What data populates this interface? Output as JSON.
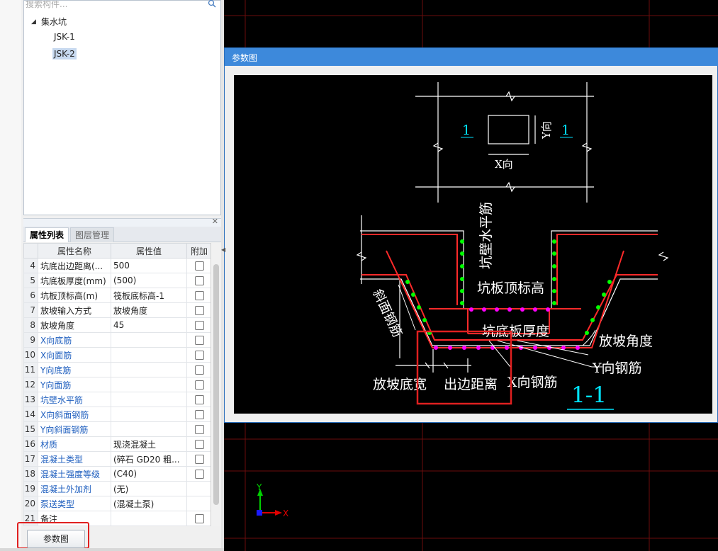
{
  "search": {
    "placeholder": "搜索构件..."
  },
  "tree": {
    "root": "集水坑",
    "items": [
      "JSK-1",
      "JSK-2"
    ],
    "selected": "JSK-2"
  },
  "prop_panel": {
    "tabs": [
      {
        "label": "属性列表",
        "active": true
      },
      {
        "label": "图层管理",
        "active": false
      }
    ],
    "headers": [
      "属性名称",
      "属性值",
      "附加"
    ],
    "rows": [
      {
        "n": "4",
        "name": "坑底出边距离(...",
        "value": "500",
        "blue": false,
        "checkbox": true
      },
      {
        "n": "5",
        "name": "坑底板厚度(mm)",
        "value": "(500)",
        "blue": false,
        "checkbox": true
      },
      {
        "n": "6",
        "name": "坑板顶标高(m)",
        "value": "筏板底标高-1",
        "blue": false,
        "checkbox": true
      },
      {
        "n": "7",
        "name": "放坡输入方式",
        "value": "放坡角度",
        "blue": false,
        "checkbox": true
      },
      {
        "n": "8",
        "name": "放坡角度",
        "value": "45",
        "blue": false,
        "checkbox": true
      },
      {
        "n": "9",
        "name": "X向底筋",
        "value": "",
        "blue": true,
        "checkbox": true
      },
      {
        "n": "10",
        "name": "X向面筋",
        "value": "",
        "blue": true,
        "checkbox": true
      },
      {
        "n": "11",
        "name": "Y向底筋",
        "value": "",
        "blue": true,
        "checkbox": true
      },
      {
        "n": "12",
        "name": "Y向面筋",
        "value": "",
        "blue": true,
        "checkbox": true
      },
      {
        "n": "13",
        "name": "坑壁水平筋",
        "value": "",
        "blue": true,
        "checkbox": true
      },
      {
        "n": "14",
        "name": "X向斜面钢筋",
        "value": "",
        "blue": true,
        "checkbox": true
      },
      {
        "n": "15",
        "name": "Y向斜面钢筋",
        "value": "",
        "blue": true,
        "checkbox": true
      },
      {
        "n": "16",
        "name": "材质",
        "value": "现浇混凝土",
        "blue": true,
        "checkbox": true
      },
      {
        "n": "17",
        "name": "混凝土类型",
        "value": "(碎石 GD20 粗...",
        "blue": true,
        "checkbox": true
      },
      {
        "n": "18",
        "name": "混凝土强度等级",
        "value": "(C40)",
        "blue": true,
        "checkbox": true
      },
      {
        "n": "19",
        "name": "混凝土外加剂",
        "value": "(无)",
        "blue": true,
        "checkbox": false
      },
      {
        "n": "20",
        "name": "泵送类型",
        "value": "(混凝土泵)",
        "blue": true,
        "checkbox": false
      },
      {
        "n": "21",
        "name": "备注",
        "value": "",
        "blue": false,
        "checkbox": true
      }
    ]
  },
  "buttons": {
    "param_diagram": "参数图"
  },
  "dialog": {
    "title": "参数图"
  },
  "diagram": {
    "plan_label_left": "1",
    "plan_label_right": "1",
    "x_dir": "X向",
    "y_dir": "Y向",
    "wall_horizontal_bar": "坑壁水平筋",
    "slab_top_elev": "坑板顶标高",
    "slope_bar": "斜面钢筋",
    "bottom_thickness": "坑底板厚度",
    "slope_angle": "放坡角度",
    "y_bar": "Y向钢筋",
    "slope_bottom_width": "放坡底宽",
    "edge_distance": "出边距离",
    "x_bar": "X向钢筋",
    "section": "1-1"
  },
  "axis": {
    "x": "X",
    "y": "Y"
  },
  "colors": {
    "accent": "#3d89db",
    "highlight_box": "#e02020",
    "cad_red": "#ff2a2a",
    "cad_green": "#00ff00",
    "cad_magenta": "#ff00ff",
    "cad_cyan": "#00e5ff",
    "grid_line": "#6b0d0d"
  }
}
